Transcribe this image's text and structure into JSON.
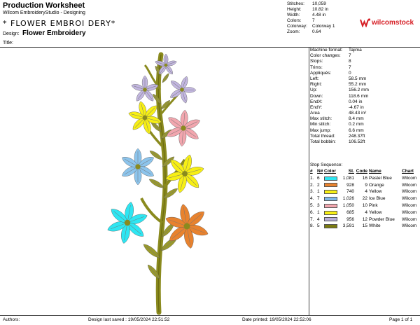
{
  "header": {
    "title": "Production Worksheet",
    "app_name": "Wilcom EmbroideryStudio - Designing",
    "design_name_display": "* FLOWER EMBROI DERY*",
    "design_label": "Design:",
    "design_value": "Flower Embroidery",
    "title_label": "Title:"
  },
  "stats": [
    {
      "label": "Stitches:",
      "value": "10,059"
    },
    {
      "label": "Height:",
      "value": "10.82 in"
    },
    {
      "label": "Width:",
      "value": "4.48 in"
    },
    {
      "label": "Colors:",
      "value": "7"
    },
    {
      "label": "Colorway:",
      "value": "Colorway 1"
    },
    {
      "label": "Zoom:",
      "value": "0.64"
    }
  ],
  "logo": {
    "text": "wilcomstock",
    "color": "#d61f26"
  },
  "machine_info": [
    {
      "label": "Machine format:",
      "value": "Tajima"
    },
    {
      "label": "Color changes:",
      "value": "7"
    },
    {
      "label": "Stops:",
      "value": "8"
    },
    {
      "label": "Trims:",
      "value": "7"
    },
    {
      "label": "Appliqués:",
      "value": "0"
    },
    {
      "label": "Left:",
      "value": "58.5 mm"
    },
    {
      "label": "Right:",
      "value": "55.2 mm"
    },
    {
      "label": "Up:",
      "value": "156.2 mm"
    },
    {
      "label": "Down:",
      "value": "118.6 mm"
    },
    {
      "label": "EndX:",
      "value": "0.04 in"
    },
    {
      "label": "EndY:",
      "value": "-4.67 in"
    },
    {
      "label": "Area",
      "value": "48.43 in²"
    },
    {
      "label": "Max stitch:",
      "value": "8.4 mm"
    },
    {
      "label": "Min stitch:",
      "value": "0.2 mm"
    },
    {
      "label": "Max jump:",
      "value": "6.6 mm"
    },
    {
      "label": "Total thread:",
      "value": "248.37ft"
    },
    {
      "label": "Total bobbin:",
      "value": "106.52ft"
    }
  ],
  "stop_sequence": {
    "title": "Stop Sequence:",
    "headers": {
      "num": "#",
      "n": "N#",
      "color": "Color",
      "st": "St.",
      "code": "Code",
      "name": "Name",
      "chart": "Chart"
    },
    "rows": [
      {
        "num": "1.",
        "n": "6",
        "color": "#2ee6f2",
        "st": "1,081",
        "code": "16",
        "name": "Pastel Blue",
        "chart": "Wilcom"
      },
      {
        "num": "2.",
        "n": "2",
        "color": "#e8822e",
        "st": "928",
        "code": "9",
        "name": "Orange",
        "chart": "Wilcom"
      },
      {
        "num": "3.",
        "n": "1",
        "color": "#f7ef14",
        "st": "740",
        "code": "4",
        "name": "Yellow",
        "chart": "Wilcom"
      },
      {
        "num": "4.",
        "n": "7",
        "color": "#7fb8e6",
        "st": "1,026",
        "code": "22",
        "name": "Ice Blue",
        "chart": "Wilcom"
      },
      {
        "num": "5.",
        "n": "3",
        "color": "#f2a6ae",
        "st": "1,050",
        "code": "10",
        "name": "Pink",
        "chart": "Wilcom"
      },
      {
        "num": "6.",
        "n": "1",
        "color": "#f7ef14",
        "st": "685",
        "code": "4",
        "name": "Yellow",
        "chart": "Wilcom"
      },
      {
        "num": "7.",
        "n": "4",
        "color": "#b7aed9",
        "st": "956",
        "code": "12",
        "name": "Powder Blue",
        "chart": "Wilcom"
      },
      {
        "num": "8.",
        "n": "5",
        "color": "#7a7a10",
        "st": "3,591",
        "code": "15",
        "name": "White",
        "chart": "Wilcom"
      }
    ]
  },
  "footer": {
    "authors_label": "Authors:",
    "last_saved": "Design last saved : 19/05/2024 22:51:52",
    "printed": "Date printed: 19/05/2024 22:52:06",
    "page": "Page 1 of 1"
  },
  "palette": {
    "stem": "#8a8a1e",
    "stem_dark": "#6b6b10",
    "leaf": "#9a9a2a",
    "cyan": "#2ee6f2",
    "orange": "#e8822e",
    "yellow": "#f7ef14",
    "ice": "#8cc4ec",
    "pink": "#f2a6ae",
    "lavender": "#c2b6e0"
  }
}
